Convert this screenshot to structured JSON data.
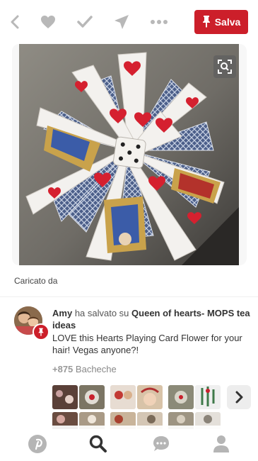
{
  "toolbar": {
    "back_icon": "back-arrow-icon",
    "like_icon": "heart-icon",
    "done_icon": "checkmark-icon",
    "send_icon": "send-icon",
    "more_icon": "more-dots-icon",
    "save_label": "Salva",
    "save_icon": "pushpin-icon",
    "accent_color": "#cc1f2a"
  },
  "pin": {
    "visual_search_icon": "visual-search-icon",
    "uploaded_by_label": "Caricato da"
  },
  "activity": {
    "user_name": "Amy",
    "saved_verb": "ha salvato su",
    "board_name": "Queen of hearts- MOPS tea ideas",
    "description": "LOVE this Hearts Playing Card Flower for your hair! Vegas anyone?!",
    "boards_count": "+875",
    "boards_label": "Bacheche",
    "next_icon": "chevron-right-icon"
  },
  "bottom_nav": {
    "items": [
      {
        "icon": "pinterest-logo-icon"
      },
      {
        "icon": "search-icon"
      },
      {
        "icon": "chat-icon"
      },
      {
        "icon": "profile-icon"
      }
    ]
  }
}
